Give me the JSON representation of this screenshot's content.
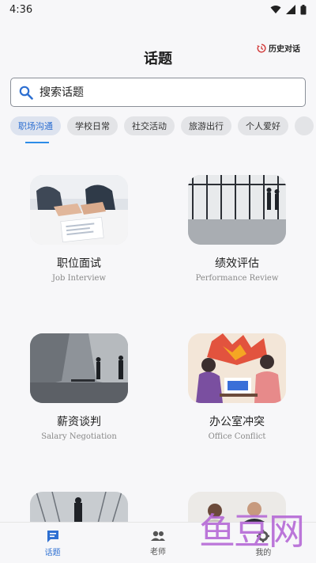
{
  "status": {
    "time": "4:36"
  },
  "header": {
    "title": "话题",
    "history_label": "历史对话"
  },
  "search": {
    "placeholder": "搜索话题"
  },
  "categories": [
    {
      "label": "职场沟通",
      "active": true
    },
    {
      "label": "学校日常"
    },
    {
      "label": "社交活动"
    },
    {
      "label": "旅游出行"
    },
    {
      "label": "个人爱好"
    }
  ],
  "topics": [
    {
      "title": "职位面试",
      "subtitle": "Job Interview"
    },
    {
      "title": "绩效评估",
      "subtitle": "Performance Review"
    },
    {
      "title": "薪资谈判",
      "subtitle": "Salary Negotiation"
    },
    {
      "title": "办公室冲突",
      "subtitle": "Office Conflict"
    }
  ],
  "nav": [
    {
      "label": "话题",
      "icon": "chat-icon",
      "active": true
    },
    {
      "label": "老师",
      "icon": "people-icon"
    },
    {
      "label": "我的",
      "icon": "gear-icon"
    }
  ],
  "watermark": "鱼豆网",
  "colors": {
    "accent": "#2d6fd1",
    "chip_bg": "#e3e4e7",
    "watermark": "#b569d6"
  }
}
